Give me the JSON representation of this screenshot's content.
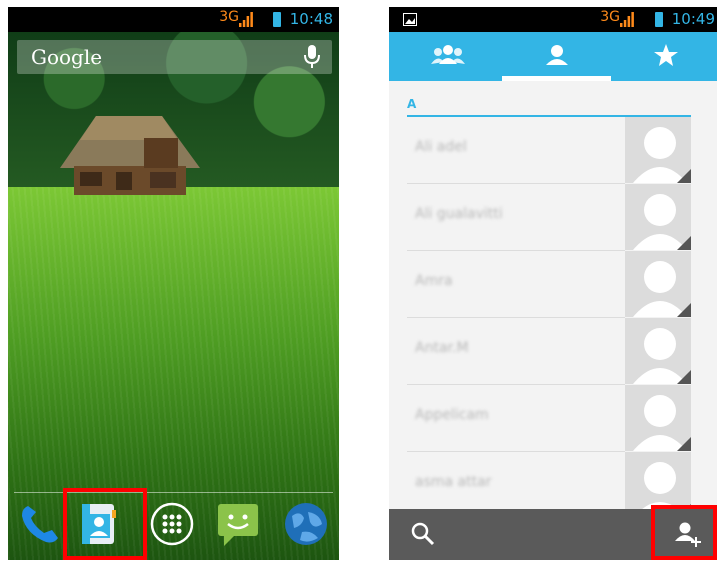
{
  "left_phone": {
    "status": {
      "network": "3G",
      "time": "10:48"
    },
    "search_widget": {
      "label": "Google"
    },
    "dock": [
      "phone-app",
      "contacts-app",
      "app-drawer",
      "messaging-app",
      "browser-app"
    ],
    "highlight": "contacts-app"
  },
  "right_phone": {
    "status": {
      "network": "3G",
      "time": "10:49"
    },
    "tabs": [
      "groups",
      "contacts",
      "favorites"
    ],
    "selected_tab": "contacts",
    "section_header": "A",
    "contacts": [
      {
        "name": "Ali adel"
      },
      {
        "name": "Ali gualavitti"
      },
      {
        "name": "Amra"
      },
      {
        "name": "Antar.M"
      },
      {
        "name": "Appelicam"
      },
      {
        "name": "asma attar"
      }
    ],
    "bottom_bar": {
      "left": "search",
      "right": "add-contact"
    },
    "highlight": "add-contact"
  },
  "colors": {
    "accent": "#33b5e5",
    "highlight": "#ff0000",
    "network": "#ff8a1a"
  }
}
